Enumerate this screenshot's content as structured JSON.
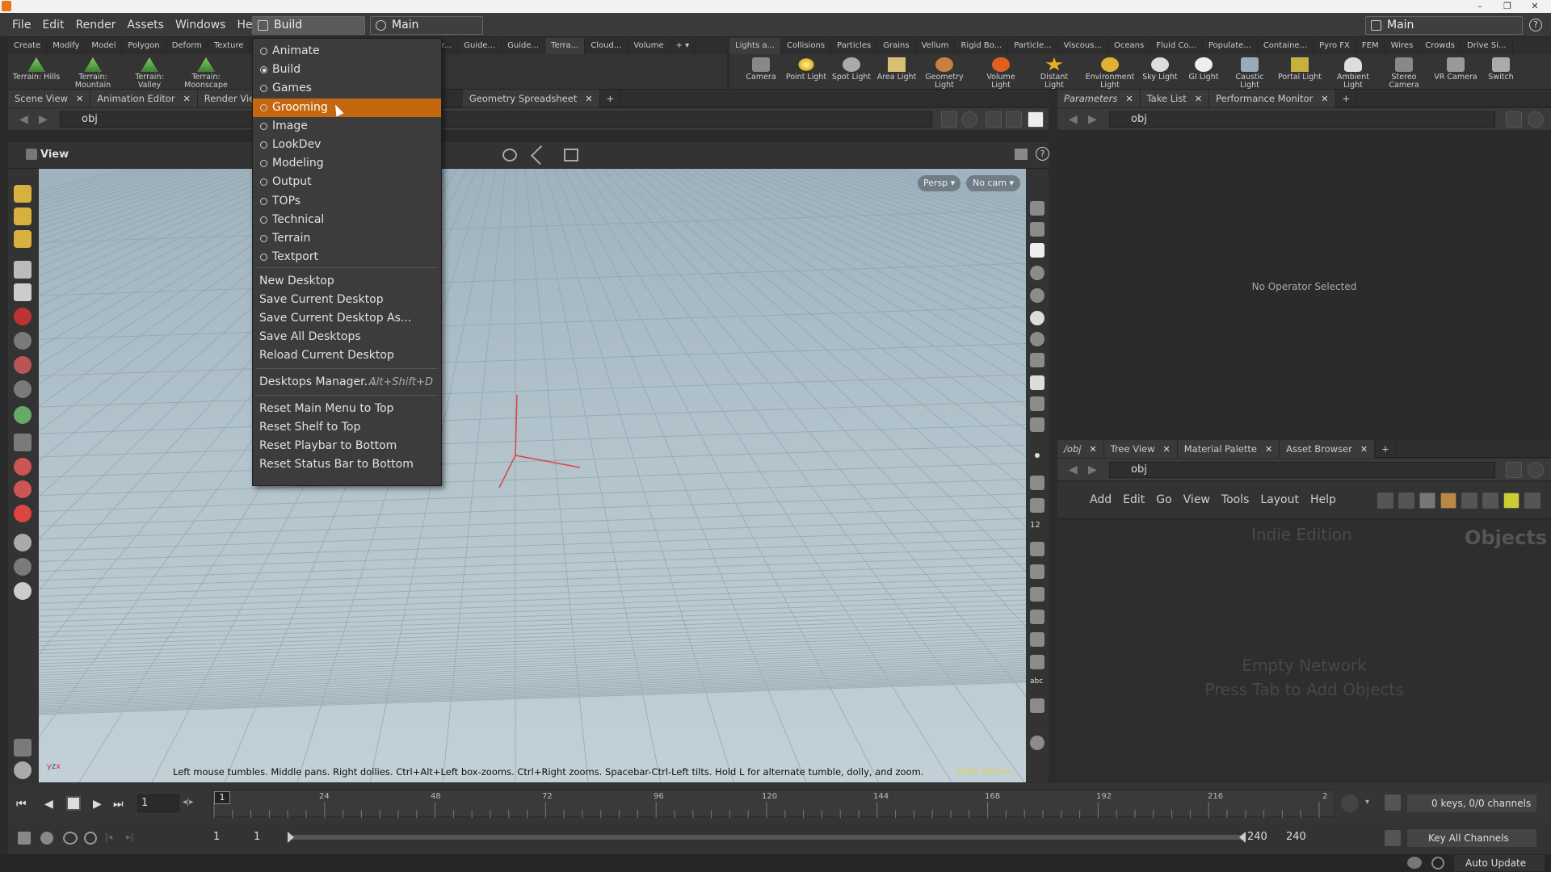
{
  "menubar": {
    "items": [
      "File",
      "Edit",
      "Render",
      "Assets",
      "Windows",
      "Help"
    ],
    "desktop_select": "Build",
    "network_select": "Main",
    "right_desktop": "Main"
  },
  "shelf_left": {
    "tabs": [
      "Create",
      "Modify",
      "Model",
      "Polygon",
      "Deform",
      "Texture",
      "r...",
      "Guide...",
      "Guide...",
      "Terra...",
      "Cloud...",
      "Volume"
    ],
    "tools": [
      "Terrain: Hills",
      "Terrain: Mountain",
      "Terrain: Valley",
      "Terrain: Moonscape"
    ]
  },
  "shelf_right": {
    "tabs": [
      "Lights a...",
      "Collisions",
      "Particles",
      "Grains",
      "Vellum",
      "Rigid Bo...",
      "Particle...",
      "Viscous...",
      "Oceans",
      "Fluid Co...",
      "Populate...",
      "Containe...",
      "Pyro FX",
      "FEM",
      "Wires",
      "Crowds",
      "Drive Si..."
    ],
    "tools": [
      "Camera",
      "Point Light",
      "Spot Light",
      "Area Light",
      "Geometry Light",
      "Volume Light",
      "Distant Light",
      "Environment Light",
      "Sky Light",
      "GI Light",
      "Caustic Light",
      "Portal Light",
      "Ambient Light",
      "Stereo Camera",
      "VR Camera",
      "Switch"
    ]
  },
  "left_pane": {
    "tabs": [
      "Scene View",
      "Animation Editor",
      "Render View",
      "Geometry Spreadsheet"
    ],
    "path": "obj",
    "view_label": "View",
    "persp": "Persp ▾",
    "cam": "No cam ▾",
    "hint": "Left mouse tumbles. Middle pans. Right dollies. Ctrl+Alt+Left box-zooms. Ctrl+Right zooms. Spacebar-Ctrl-Left tilts. Hold L for alternate tumble, dolly, and zoom.",
    "watermark": "Indie Edition"
  },
  "right_top_pane": {
    "tabs": [
      "Parameters",
      "Take List",
      "Performance Monitor"
    ],
    "path": "obj",
    "message": "No Operator Selected"
  },
  "right_bottom_pane": {
    "tabs": [
      "/obj",
      "Tree View",
      "Material Palette",
      "Asset Browser"
    ],
    "path": "obj",
    "menu": [
      "Add",
      "Edit",
      "Go",
      "View",
      "Tools",
      "Layout",
      "Help"
    ],
    "edition": "Indie Edition",
    "context": "Objects",
    "empty_line1": "Empty Network",
    "empty_line2": "Press Tab to Add Objects"
  },
  "timeline": {
    "current_frame": "1",
    "ticks": [
      "1",
      "24",
      "48",
      "72",
      "96",
      "120",
      "144",
      "168",
      "192",
      "216",
      "2"
    ],
    "range_start": "1",
    "range_start2": "1",
    "range_end": "240",
    "range_end2": "240",
    "keys_info": "0 keys, 0/0 channels",
    "key_all": "Key All Channels"
  },
  "statusbar": {
    "auto_update": "Auto Update"
  },
  "dropdown": {
    "desktops": [
      {
        "label": "Animate",
        "selected": false
      },
      {
        "label": "Build",
        "selected": true
      },
      {
        "label": "Games",
        "selected": false
      },
      {
        "label": "Grooming",
        "selected": false,
        "highlighted": true
      },
      {
        "label": "Image",
        "selected": false
      },
      {
        "label": "LookDev",
        "selected": false
      },
      {
        "label": "Modeling",
        "selected": false
      },
      {
        "label": "Output",
        "selected": false
      },
      {
        "label": "TOPs",
        "selected": false
      },
      {
        "label": "Technical",
        "selected": false
      },
      {
        "label": "Terrain",
        "selected": false
      },
      {
        "label": "Textport",
        "selected": false
      }
    ],
    "actions1": [
      "New Desktop",
      "Save Current Desktop",
      "Save Current Desktop As...",
      "Save All Desktops",
      "Reload Current Desktop"
    ],
    "manager": "Desktops Manager...",
    "manager_shortcut": "Alt+Shift+D",
    "actions2": [
      "Reset Main Menu to Top",
      "Reset Shelf to Top",
      "Reset Playbar to Bottom",
      "Reset Status Bar to Bottom"
    ]
  },
  "colors": {
    "highlight": "#c5670e",
    "viewport_top": "#9fb2bd",
    "viewport_bottom": "#c2d0d7"
  }
}
